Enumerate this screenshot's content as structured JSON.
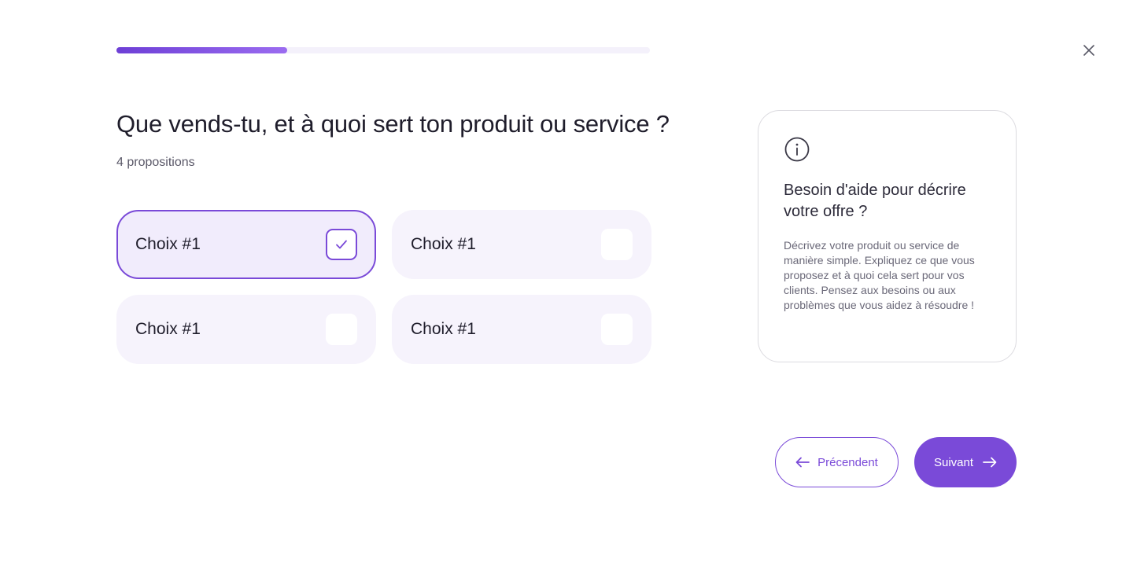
{
  "progress": {
    "value": 0.32
  },
  "question": {
    "title": "Que vends-tu, et à quoi sert ton produit ou service ?",
    "subtitle": "4 propositions"
  },
  "choices": [
    {
      "label": "Choix #1",
      "selected": true
    },
    {
      "label": "Choix #1",
      "selected": false
    },
    {
      "label": "Choix #1",
      "selected": false
    },
    {
      "label": "Choix #1",
      "selected": false
    }
  ],
  "help": {
    "icon": "info-icon",
    "title": "Besoin d'aide pour décrire votre offre ?",
    "text": "Décrivez votre produit ou service de manière simple. Expliquez ce que vous proposez et à quoi cela sert pour vos clients. Pensez aux besoins ou aux problèmes que vous aidez à résoudre !"
  },
  "nav": {
    "prev_label": "Précendent",
    "next_label": "Suivant"
  },
  "colors": {
    "accent": "#7a4ad8",
    "choice_bg": "#f6f3fc",
    "track": "#f4f1fb"
  }
}
